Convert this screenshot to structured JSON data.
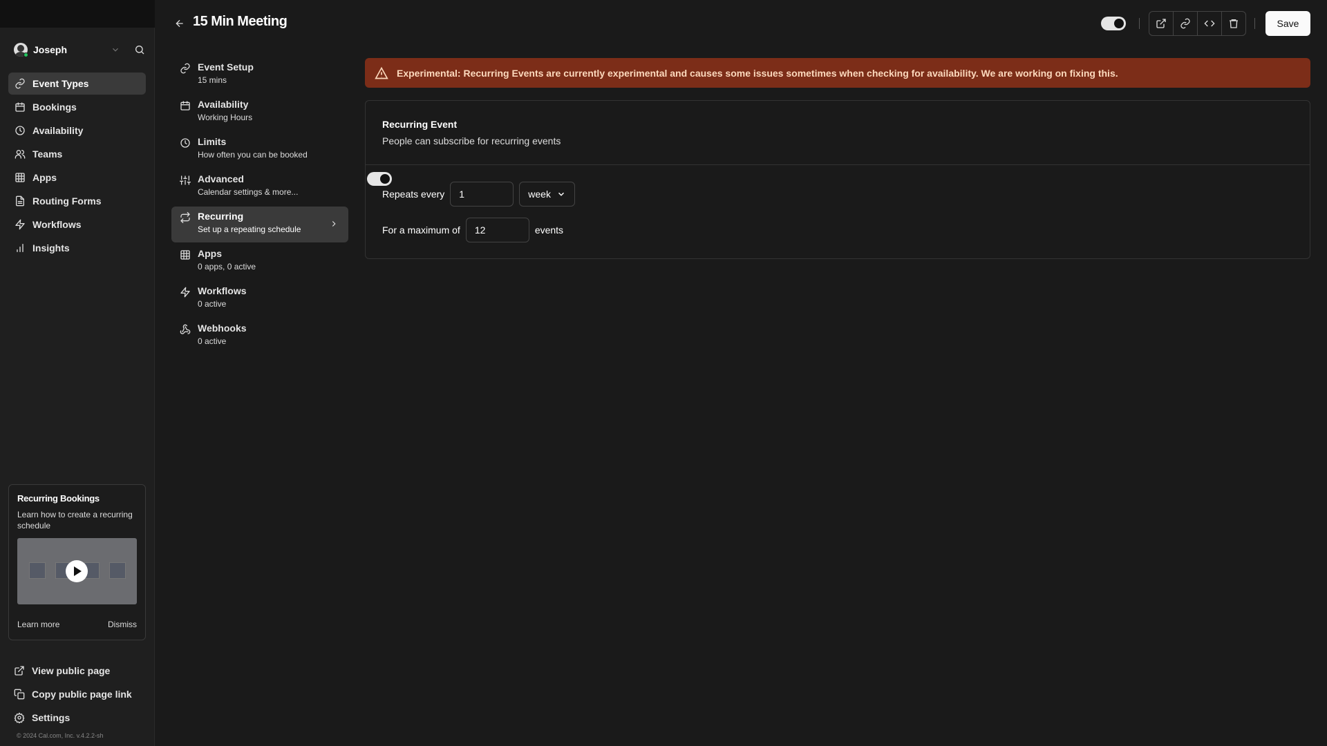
{
  "user": {
    "name": "Joseph"
  },
  "sidebar": {
    "items": [
      {
        "label": "Event Types",
        "icon": "link-icon",
        "active": true
      },
      {
        "label": "Bookings",
        "icon": "calendar-icon"
      },
      {
        "label": "Availability",
        "icon": "clock-icon"
      },
      {
        "label": "Teams",
        "icon": "users-icon"
      },
      {
        "label": "Apps",
        "icon": "grid-icon"
      },
      {
        "label": "Routing Forms",
        "icon": "file-icon"
      },
      {
        "label": "Workflows",
        "icon": "zap-icon"
      },
      {
        "label": "Insights",
        "icon": "bar-chart-icon"
      }
    ],
    "promo": {
      "title": "Recurring Bookings",
      "desc": "Learn how to create a recurring schedule",
      "learn_more": "Learn more",
      "dismiss": "Dismiss"
    },
    "bottom": [
      {
        "label": "View public page",
        "icon": "external-link-icon"
      },
      {
        "label": "Copy public page link",
        "icon": "copy-icon"
      },
      {
        "label": "Settings",
        "icon": "gear-icon"
      }
    ],
    "copyright": "© 2024 Cal.com, Inc. v.4.2.2-sh"
  },
  "header": {
    "title": "15 Min Meeting",
    "save": "Save",
    "hidden_toggle_on": true
  },
  "subnav": [
    {
      "title": "Event Setup",
      "sub": "15 mins",
      "icon": "link-icon"
    },
    {
      "title": "Availability",
      "sub": "Working Hours",
      "icon": "calendar-icon"
    },
    {
      "title": "Limits",
      "sub": "How often you can be booked",
      "icon": "clock-icon"
    },
    {
      "title": "Advanced",
      "sub": "Calendar settings & more...",
      "icon": "sliders-icon"
    },
    {
      "title": "Recurring",
      "sub": "Set up a repeating schedule",
      "icon": "repeat-icon",
      "active": true
    },
    {
      "title": "Apps",
      "sub": "0 apps, 0 active",
      "icon": "grid-icon"
    },
    {
      "title": "Workflows",
      "sub": "0 active",
      "icon": "zap-icon"
    },
    {
      "title": "Webhooks",
      "sub": "0 active",
      "icon": "webhook-icon"
    }
  ],
  "banner": {
    "text": "Experimental: Recurring Events are currently experimental and causes some issues sometimes when checking for availability. We are working on fixing this.",
    "color": "#7c2d18"
  },
  "recurring": {
    "title": "Recurring Event",
    "desc": "People can subscribe for recurring events",
    "enabled": true,
    "repeats_label": "Repeats every",
    "repeats_value": "1",
    "unit": "week",
    "max_label": "For a maximum of",
    "max_value": "12",
    "events_label": "events"
  }
}
